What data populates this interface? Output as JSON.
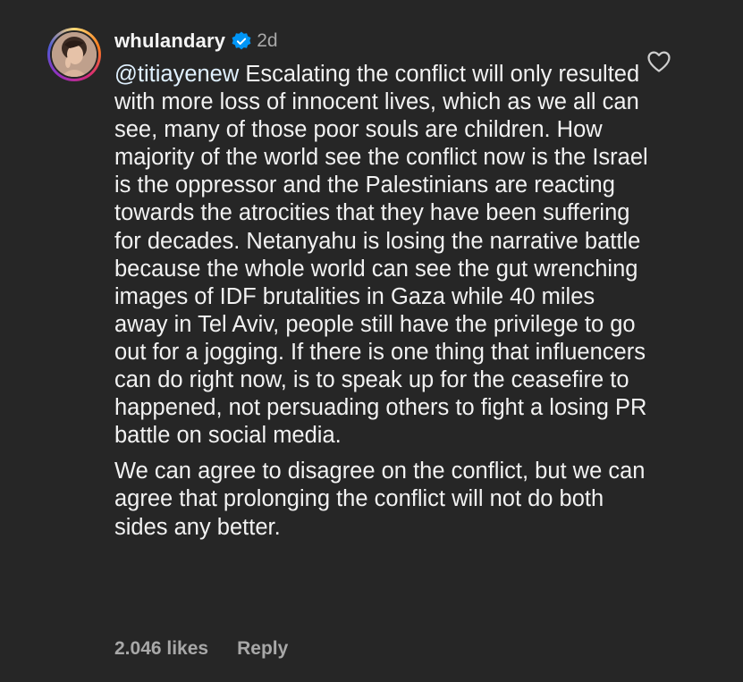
{
  "comment": {
    "username": "whulandary",
    "verified": true,
    "time": "2d",
    "mention": "@titiayenew",
    "text_part1": " Escalating the conflict will only resulted with more loss of innocent lives, which as we all can see, many of those poor souls are children. How majority of the world see the conflict now is the Israel is the oppressor and the Palestinians are reacting towards the atrocities that they have been suffering for decades. Netanyahu is losing the narrative battle because the whole world can see the gut wrenching images of IDF brutalities in Gaza while 40 miles away in Tel Aviv, people still have the privilege to go out for a jogging. If there is one thing that influencers can do right now, is to speak up for the ceasefire to happened, not persuading others to fight a losing PR battle on social media.",
    "text_part2": "We can agree to disagree on the conflict, but we can agree that prolonging the conflict will not do both sides any better.",
    "likes": "2.046 likes",
    "reply_label": "Reply"
  },
  "icons": {
    "avatar": "profile-avatar",
    "verified": "verified-badge-icon",
    "like": "heart-outline-icon"
  },
  "colors": {
    "background": "#262626",
    "text": "#f2f2f2",
    "secondary": "#a8a8a8",
    "mention": "#e0f1ff",
    "verified": "#0095f6"
  }
}
